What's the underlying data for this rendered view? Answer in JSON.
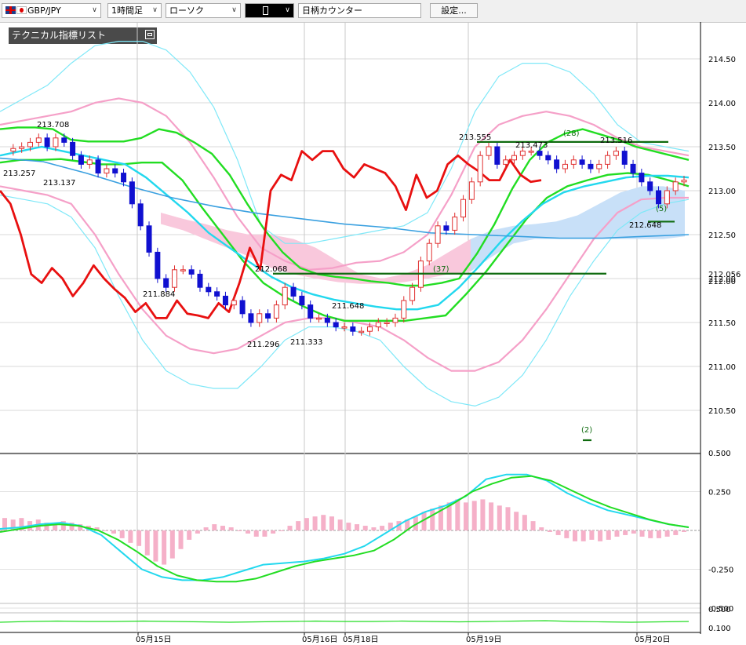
{
  "toolbar": {
    "symbol": "GBP/JPY",
    "timeframe": "1時間足",
    "chart_style": "ローソク",
    "counter": "日柄カウンター",
    "settings": "設定..."
  },
  "indicator_panel": {
    "title": "テクニカル指標リスト"
  },
  "colors": {
    "candle_up": "#e03030",
    "candle_down": "#1010d0",
    "bb_outer": "#7fe8f8",
    "bb_inner": "#f5a0c8",
    "ma_green": "#22dd22",
    "ma_cyan": "#22d8ee",
    "ma_blue": "#3aa0e0",
    "span_red": "#e81010",
    "kumo_pink": "#f9c8dc",
    "kumo_blue": "#c8e0f8",
    "level_line": "#0f6b0f",
    "macd_line": "#22d8ee",
    "signal_line": "#22dd22",
    "hist": "#f5b0c8"
  },
  "chart_data": {
    "type": "line",
    "title": "",
    "price_axis": {
      "range": [
        210.3,
        214.6
      ],
      "ticks": [
        "214.50",
        "214.00",
        "213.50",
        "213.00",
        "212.50",
        "212.00",
        "211.50",
        "211.00",
        "210.50"
      ]
    },
    "time_axis": {
      "labels": [
        "05月15日",
        "05月16日",
        "05月18日",
        "05月19日",
        "05月20日"
      ]
    },
    "price_labels": [
      "213.708",
      "213.257",
      "213.137",
      "211.884",
      "211.296",
      "212.068",
      "211.333",
      "211.648",
      "213.555",
      "213.473",
      "213.516",
      "212.648",
      "212.056",
      "212.00"
    ],
    "counters": [
      "(28)",
      "(37)",
      "(5)",
      "(2)"
    ],
    "horizontal_levels": [
      {
        "value": 213.555
      },
      {
        "value": 212.056
      },
      {
        "value": 212.648
      }
    ],
    "series": [
      {
        "values": [
          213.7,
          213.72,
          213.72,
          213.7,
          213.58,
          213.56,
          213.56,
          213.56,
          213.6,
          213.7,
          213.66,
          213.55,
          213.42,
          213.18,
          212.85,
          212.55,
          212.3,
          212.12,
          212.05,
          212.02,
          212.0,
          211.97,
          211.95,
          211.92,
          211.92,
          211.95,
          212.0,
          212.28,
          212.62,
          213.02,
          213.35,
          213.55,
          213.65,
          213.7,
          213.64,
          213.58,
          213.5,
          213.45,
          213.4,
          213.35
        ]
      },
      {
        "values": [
          213.32,
          213.35,
          213.35,
          213.36,
          213.33,
          213.3,
          213.3,
          213.32,
          213.32,
          213.12,
          212.8,
          212.5,
          212.2,
          211.95,
          211.8,
          211.68,
          211.58,
          211.52,
          211.52,
          211.52,
          211.52,
          211.55,
          211.58,
          211.82,
          212.08,
          212.38,
          212.68,
          212.92,
          213.05,
          213.12,
          213.18,
          213.2,
          213.18,
          213.12,
          213.05
        ]
      },
      {
        "values": [
          213.4,
          213.45,
          213.5,
          213.45,
          213.4,
          213.35,
          213.3,
          213.15,
          212.95,
          212.75,
          212.52,
          212.35,
          212.18,
          212.02,
          211.9,
          211.82,
          211.76,
          211.72,
          211.68,
          211.65,
          211.65,
          211.7,
          211.9,
          212.15,
          212.42,
          212.65,
          212.85,
          212.98,
          213.05,
          213.1,
          213.15,
          213.17,
          213.17,
          213.15
        ]
      },
      {
        "values": [
          213.37,
          213.33,
          213.2,
          213.05,
          212.92,
          212.82,
          212.74,
          212.68,
          212.62,
          212.58,
          212.52,
          212.5,
          212.48,
          212.46,
          212.46,
          212.48,
          212.5
        ]
      }
    ]
  },
  "macd_axis": {
    "ticks": [
      "0.500",
      "0.250",
      "-0.250",
      "-0.500"
    ]
  },
  "sub_axis": {
    "ticks": [
      "0.500",
      "0.100"
    ]
  }
}
